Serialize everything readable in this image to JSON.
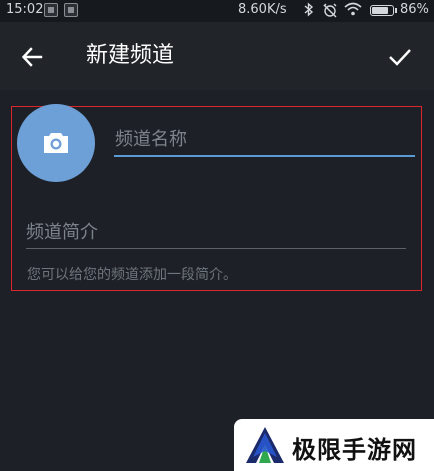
{
  "status_bar": {
    "time": "15:02",
    "network_speed": "8.60K/s",
    "battery_percent": "86%",
    "battery_level": 0.86,
    "icons": [
      "notification-icon",
      "bluetooth-icon",
      "alarm-off-icon",
      "wifi-icon",
      "battery-icon"
    ]
  },
  "app_bar": {
    "title": "新建频道",
    "back_icon": "arrow-back-icon",
    "done_icon": "check-icon"
  },
  "form": {
    "avatar_icon": "camera-icon",
    "avatar_color": "#6ea0d8",
    "name_input": {
      "value": "",
      "placeholder": "频道名称"
    },
    "description_input": {
      "value": "",
      "placeholder": "频道简介"
    },
    "hint": "您可以给您的频道添加一段简介。",
    "accent_color": "#5b9bd5",
    "outline_color": "#d8262c"
  },
  "watermark": {
    "text": "极限手游网"
  }
}
